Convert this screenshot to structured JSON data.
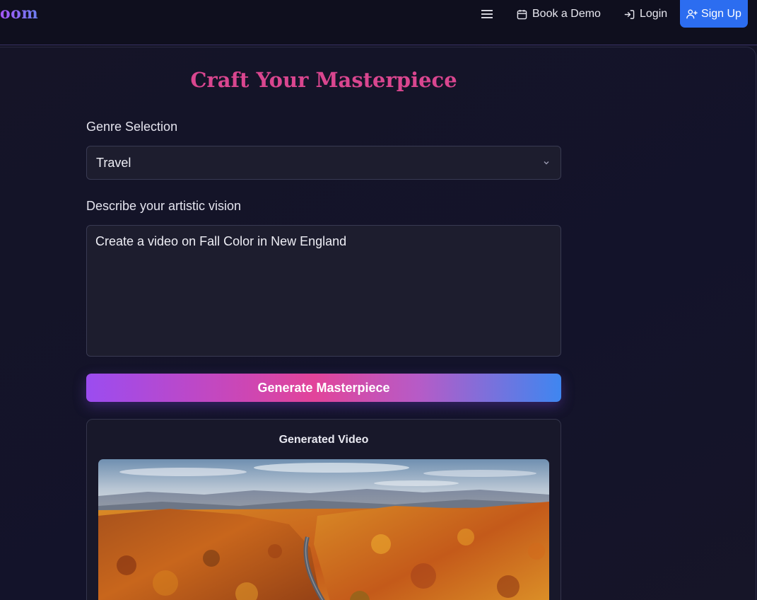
{
  "header": {
    "logo_text": "oom",
    "menu_icon": "hamburger-menu-icon",
    "book_demo_label": "Book a Demo",
    "book_demo_icon": "calendar-icon",
    "login_label": "Login",
    "login_icon": "login-arrow-icon",
    "signup_label": "Sign Up",
    "signup_icon": "user-plus-icon"
  },
  "main": {
    "title": "Craft Your Masterpiece",
    "genre_label": "Genre Selection",
    "genre_value": "Travel",
    "vision_label": "Describe your artistic vision",
    "vision_value": "Create a video on Fall Color in New England",
    "generate_label": "Generate Masterpiece",
    "result_title": "Generated Video"
  },
  "colors": {
    "background": "#11111f",
    "accent_pink": "#d9468f",
    "signup_blue": "#2c6df0",
    "gradient_start": "#9b4cf0",
    "gradient_mid": "#e2449a",
    "gradient_end": "#3f86f0"
  }
}
